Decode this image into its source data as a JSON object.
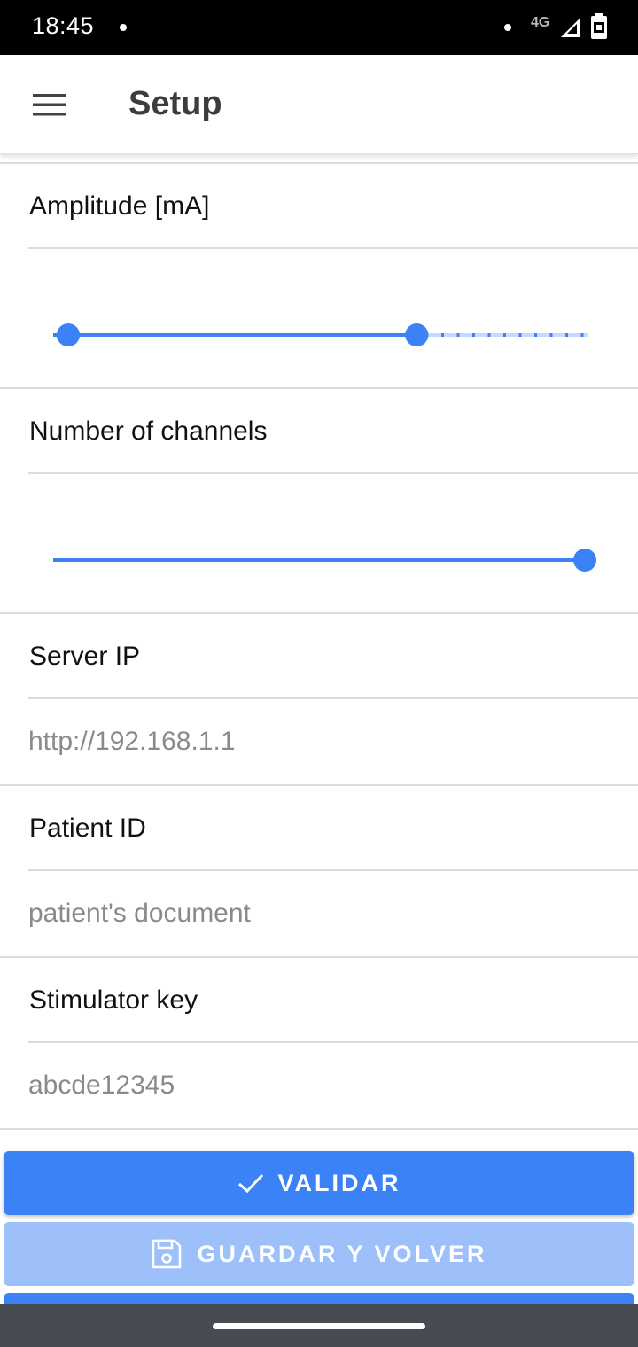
{
  "status_bar": {
    "time": "18:45",
    "network": "4G",
    "icons": [
      "notification-dot-icon",
      "signal-icon",
      "battery-icon"
    ]
  },
  "app_bar": {
    "title": "Setup",
    "menu_icon": "hamburger-menu-icon"
  },
  "amplitude": {
    "label": "Amplitude [mA]",
    "range_start_fraction": 0.0,
    "range_end_fraction": 0.67
  },
  "channels": {
    "label": "Number of channels",
    "value_fraction": 1.0
  },
  "server_ip": {
    "label": "Server IP",
    "value": "",
    "placeholder": "http://192.168.1.1"
  },
  "patient_id": {
    "label": "Patient ID",
    "value": "",
    "placeholder": "patient's document"
  },
  "stimulator_key": {
    "label": "Stimulator key",
    "value": "",
    "placeholder": "abcde12345"
  },
  "buttons": {
    "validate_label": "VALIDAR",
    "validate_icon": "check-icon",
    "save_label": "GUARDAR Y VOLVER",
    "save_icon": "save-icon"
  },
  "colors": {
    "accent": "#3b82f6",
    "accent_disabled": "#9dbffa",
    "status_bar": "#000000",
    "nav_bar": "#474b52"
  }
}
